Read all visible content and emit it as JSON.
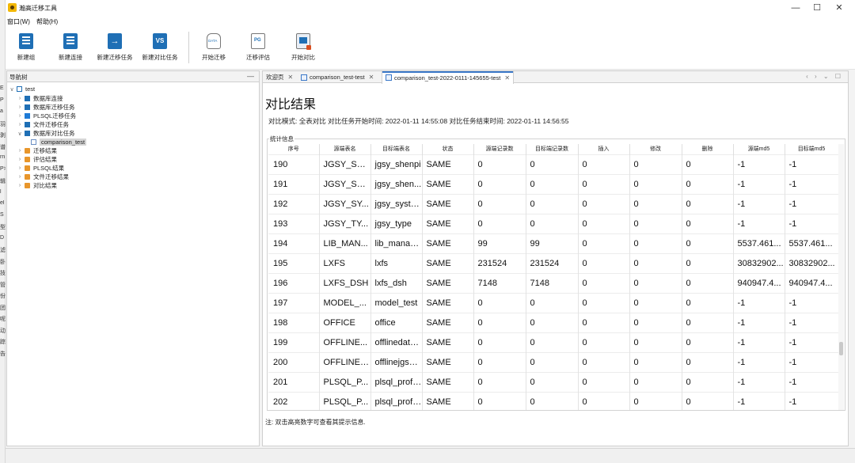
{
  "window": {
    "title": "瀚高迁移工具",
    "controls": {
      "minimize": "—",
      "maximize": "☐",
      "close": "✕"
    }
  },
  "menu": [
    "窗口(W)",
    "帮助(H)"
  ],
  "toolbar": [
    {
      "label": "新建组",
      "icon": "new-group-icon"
    },
    {
      "label": "新建连接",
      "icon": "new-connection-icon"
    },
    {
      "label": "新建迁移任务",
      "icon": "new-migration-task-icon"
    },
    {
      "label": "新建对比任务",
      "icon": "new-compare-task-icon"
    },
    {
      "label": "开始迁移",
      "icon": "start-migration-icon"
    },
    {
      "label": "迁移评估",
      "icon": "migration-assessment-icon"
    },
    {
      "label": "开始对比",
      "icon": "start-compare-icon"
    }
  ],
  "nav": {
    "title": "导航树",
    "minimize": "—",
    "root": "test",
    "items": [
      {
        "label": "数据库连接",
        "icon": "dbc"
      },
      {
        "label": "数据库迁移任务",
        "icon": "task"
      },
      {
        "label": "PLSQL迁移任务",
        "icon": "p"
      },
      {
        "label": "文件迁移任务",
        "icon": "f"
      },
      {
        "label": "数据库对比任务",
        "icon": "vs"
      },
      {
        "label": "comparison_test",
        "icon": "item"
      },
      {
        "label": "迁移结果",
        "icon": "folder"
      },
      {
        "label": "评估结果",
        "icon": "folder"
      },
      {
        "label": "PLSQL结果",
        "icon": "folder"
      },
      {
        "label": "文件迁移结果",
        "icon": "folder"
      },
      {
        "label": "对比结果",
        "icon": "folder"
      }
    ]
  },
  "tabs": [
    {
      "label": "欢迎页",
      "close": "✕"
    },
    {
      "label": "comparison_test-test",
      "close": "✕"
    },
    {
      "label": "comparison_test-2022-0111-145655-test",
      "close": "✕"
    }
  ],
  "tab_nav": "‹ › ⌄ ☐",
  "page": {
    "title": "对比结果",
    "summary": "对比模式: 全表对比  对比任务开始时间: 2022-01-11 14:55:08  对比任务结束时间: 2022-01-11 14:56:55",
    "stats_legend": "统计信息",
    "note": "注: 双击高亮数字可查看其提示信息."
  },
  "table": {
    "headers": [
      "序号",
      "源端表名",
      "目标端表名",
      "状态",
      "源端记录数",
      "目标端记录数",
      "插入",
      "修改",
      "删除",
      "源端md5",
      "目标端md5"
    ],
    "rows": [
      [
        "190",
        "JGSY_SH...",
        "jgsy_shenpi",
        "SAME",
        "0",
        "0",
        "0",
        "0",
        "0",
        "-1",
        "-1"
      ],
      [
        "191",
        "JGSY_SH...",
        "jgsy_shen...",
        "SAME",
        "0",
        "0",
        "0",
        "0",
        "0",
        "-1",
        "-1"
      ],
      [
        "192",
        "JGSY_SY...",
        "jgsy_syste...",
        "SAME",
        "0",
        "0",
        "0",
        "0",
        "0",
        "-1",
        "-1"
      ],
      [
        "193",
        "JGSY_TY...",
        "jgsy_type",
        "SAME",
        "0",
        "0",
        "0",
        "0",
        "0",
        "-1",
        "-1"
      ],
      [
        "194",
        "LIB_MAN...",
        "lib_manager",
        "SAME",
        "99",
        "99",
        "0",
        "0",
        "0",
        "5537.461...",
        "5537.461..."
      ],
      [
        "195",
        "LXFS",
        "lxfs",
        "SAME",
        "231524",
        "231524",
        "0",
        "0",
        "0",
        "30832902...",
        "30832902..."
      ],
      [
        "196",
        "LXFS_DSH",
        "lxfs_dsh",
        "SAME",
        "7148",
        "7148",
        "0",
        "0",
        "0",
        "940947.4...",
        "940947.4..."
      ],
      [
        "197",
        "MODEL_...",
        "model_test",
        "SAME",
        "0",
        "0",
        "0",
        "0",
        "0",
        "-1",
        "-1"
      ],
      [
        "198",
        "OFFICE",
        "office",
        "SAME",
        "0",
        "0",
        "0",
        "0",
        "0",
        "-1",
        "-1"
      ],
      [
        "199",
        "OFFLINE...",
        "offlinedata...",
        "SAME",
        "0",
        "0",
        "0",
        "0",
        "0",
        "-1",
        "-1"
      ],
      [
        "200",
        "OFFLINEJ...",
        "offlinejgsyl...",
        "SAME",
        "0",
        "0",
        "0",
        "0",
        "0",
        "-1",
        "-1"
      ],
      [
        "201",
        "PLSQL_P...",
        "plsql_profi...",
        "SAME",
        "0",
        "0",
        "0",
        "0",
        "0",
        "-1",
        "-1"
      ],
      [
        "202",
        "PLSQL_P...",
        "plsql_profi...",
        "SAME",
        "0",
        "0",
        "0",
        "0",
        "0",
        "-1",
        "-1"
      ]
    ]
  },
  "background_strip": [
    "E",
    "P",
    "a",
    "羽",
    "剥",
    "谱",
    "rn",
    "P>",
    "辑",
    "l",
    "el",
    "S",
    "型",
    "D",
    "滤",
    "卧",
    "技",
    "管",
    "份",
    "团",
    "呢",
    "动",
    "踪",
    "告"
  ]
}
